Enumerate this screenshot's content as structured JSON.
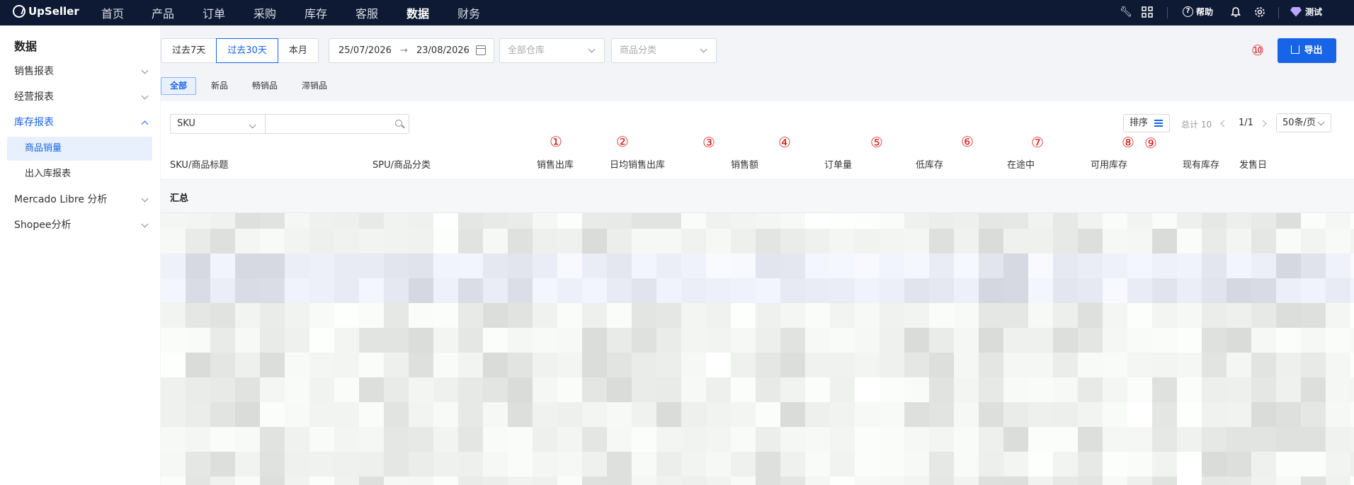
{
  "nav": {
    "brand": "UpSeller",
    "items": [
      "首页",
      "产品",
      "订单",
      "采购",
      "库存",
      "客服",
      "数据",
      "财务"
    ],
    "active_index": 6,
    "help": "帮助",
    "user": "测试"
  },
  "sidebar": {
    "title": "数据",
    "items": [
      {
        "label": "销售报表"
      },
      {
        "label": "经营报表"
      },
      {
        "label": "库存报表"
      },
      {
        "label": "商品销量"
      },
      {
        "label": "出入库报表"
      },
      {
        "label": "Mercado Libre 分析"
      },
      {
        "label": "Shopee分析"
      }
    ]
  },
  "filters": {
    "ranges": [
      "过去7天",
      "过去30天",
      "本月"
    ],
    "active_range_index": 1,
    "date_start": "25/07/2026",
    "date_end": "23/08/2026",
    "date_arrow": "→",
    "warehouse_placeholder": "全部仓库",
    "category_placeholder": "商品分类",
    "export": "导出"
  },
  "tags": [
    "全部",
    "新品",
    "畅销品",
    "滞销品"
  ],
  "table_tools": {
    "search_field": "SKU",
    "search_value": "",
    "sort": "排序",
    "total": "总计 10",
    "page": "1/1",
    "per_page": "50条/页"
  },
  "columns": [
    "SKU/商品标题",
    "SPU/商品分类",
    "销售出库",
    "日均销售出库",
    "销售额",
    "订单量",
    "低库存",
    "在途中",
    "可用库存",
    "现有库存",
    "发售日"
  ],
  "summary_label": "汇总",
  "annotations": [
    "①",
    "②",
    "③",
    "④",
    "⑤",
    "⑥",
    "⑦",
    "⑧",
    "⑨",
    "⑩"
  ],
  "colors": {
    "topbar": "#0e1a33",
    "primary": "#1764e8",
    "annotation": "#d91f1f",
    "active_bg": "#e8f0fd"
  }
}
